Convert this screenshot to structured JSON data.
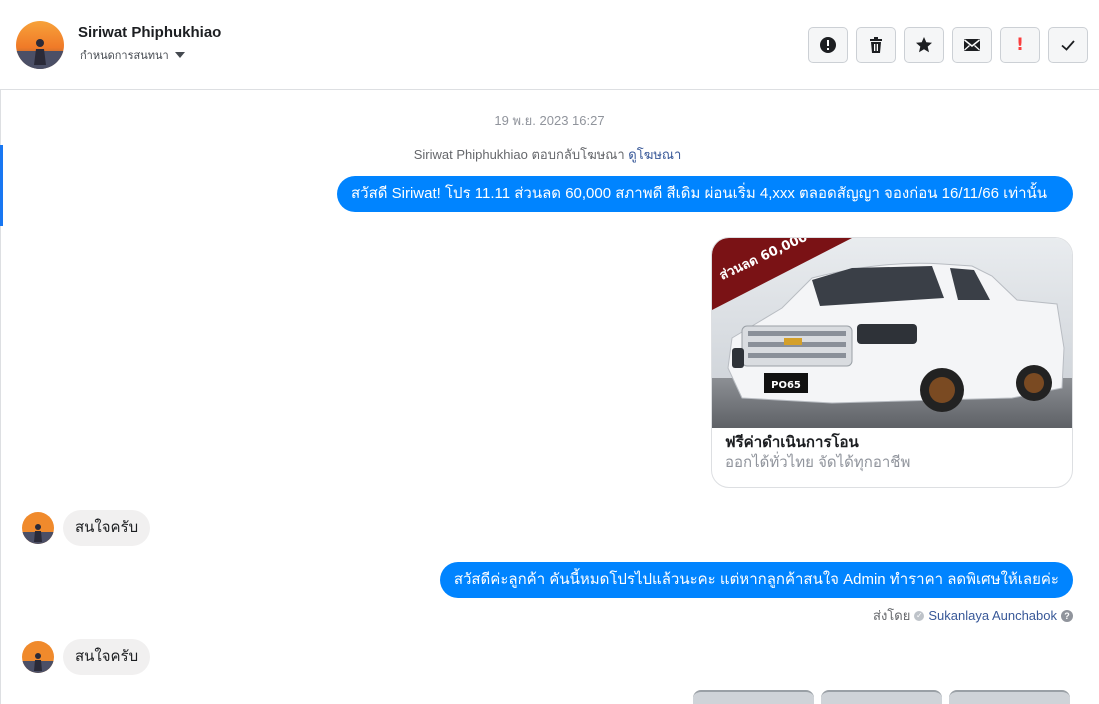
{
  "header": {
    "name": "Siriwat Phiphukhiao",
    "status_label": "กำหนดการสนทนา"
  },
  "actions": [
    {
      "icon": "alert-circle-icon",
      "label": "spam"
    },
    {
      "icon": "trash-icon",
      "label": "delete"
    },
    {
      "icon": "star-icon",
      "label": "follow-up"
    },
    {
      "icon": "envelope-icon",
      "label": "unread"
    },
    {
      "icon": "exclamation-icon",
      "label": "!"
    },
    {
      "icon": "checkmark-icon",
      "label": "done"
    }
  ],
  "conversation": {
    "timestamp": "19 พ.ย. 2023 16:27",
    "ad_reply": {
      "text": "Siriwat Phiphukhiao ตอบกลับโฆษณา",
      "link": "ดูโฆษณา"
    },
    "message_1": "สวัสดี Siriwat! โปร 11.11 ส่วนลด 60,000 สภาพดี สีเดิม ผ่อนเริ่ม 4,xxx ตลอดสัญญา จองก่อน 16/11/66 เท่านั้น",
    "card": {
      "banner_text": "ส่วนลด 60,000",
      "plate": "PO65",
      "title": "ฟรีค่าดำเนินการโอน",
      "subtitle": "ออกได้ทั่วไทย จัดได้ทุกอาชีพ"
    },
    "incoming_1": "สนใจครับ",
    "message_2": "สวัสดีค่ะลูกค้า คันนี้หมดโปรไปแล้วนะคะ แต่หากลูกค้าสนใจ Admin ทำราคา ลดพิเศษให้เลยค่ะ",
    "sent_by": {
      "label": "ส่งโดย",
      "agent": "Sukanlaya Aunchabok"
    },
    "incoming_2": "สนใจครับ"
  },
  "colors": {
    "outgoing_bubble": "#0084ff",
    "incoming_bubble": "#f1f0f0",
    "accent": "#1877f2"
  }
}
